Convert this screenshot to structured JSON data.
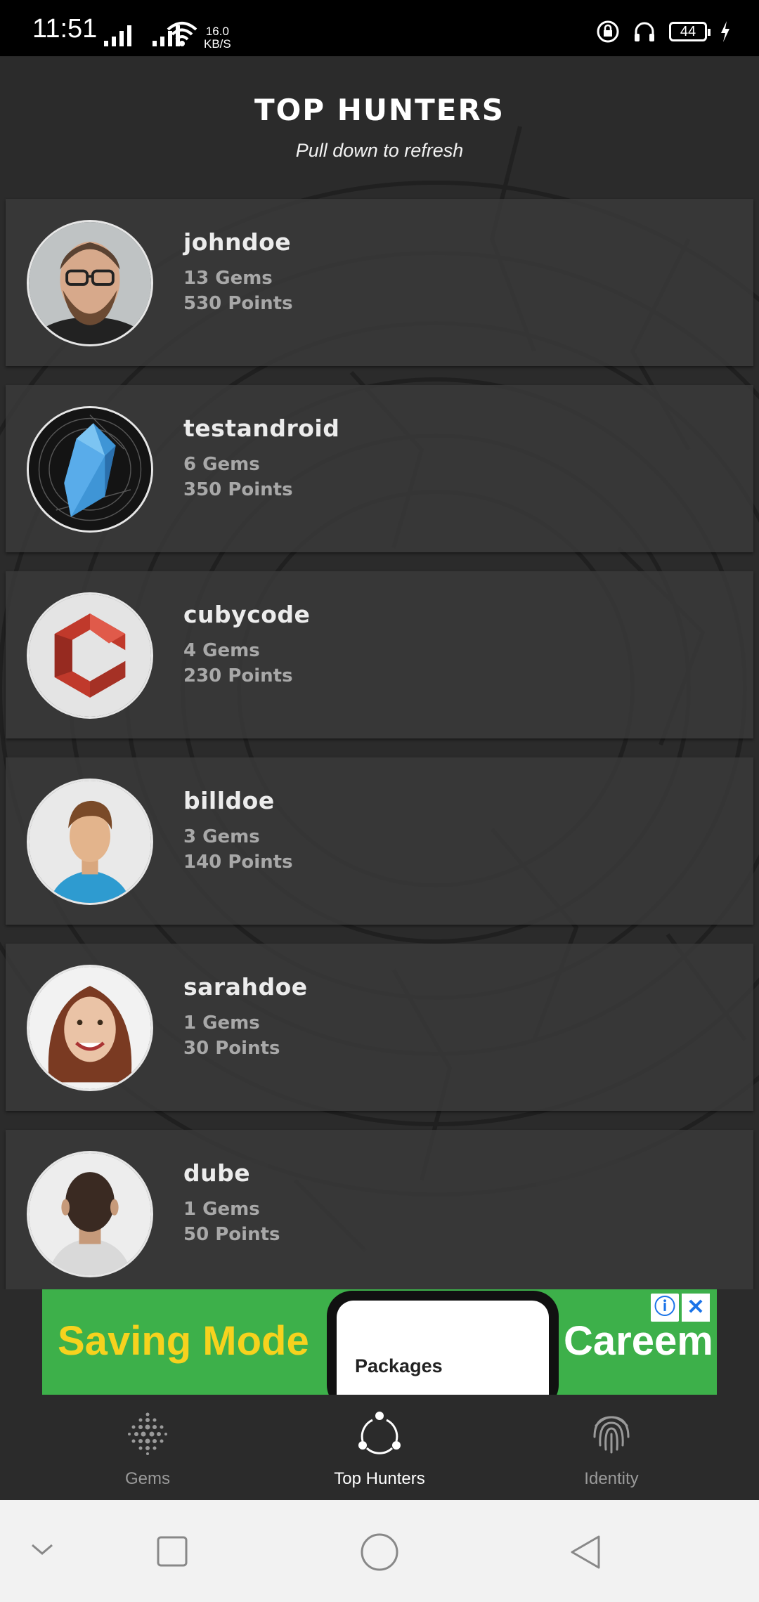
{
  "status_bar": {
    "time": "11:51",
    "speed_value": "16.0",
    "speed_unit": "KB/S",
    "battery": "44"
  },
  "header": {
    "title": "TOP HUNTERS",
    "subtitle": "Pull down to refresh"
  },
  "hunters": [
    {
      "username": "johndoe",
      "gems": "13 Gems",
      "points": "530 Points",
      "avatar": "man-glasses-beard"
    },
    {
      "username": "testandroid",
      "gems": "6 Gems",
      "points": "350 Points",
      "avatar": "blue-crystal"
    },
    {
      "username": "cubycode",
      "gems": "4 Gems",
      "points": "230 Points",
      "avatar": "red-cube-logo"
    },
    {
      "username": "billdoe",
      "gems": "3 Gems",
      "points": "140 Points",
      "avatar": "cartoon-man"
    },
    {
      "username": "sarahdoe",
      "gems": "1 Gems",
      "points": "30 Points",
      "avatar": "woman-curly-hair"
    },
    {
      "username": "dube",
      "gems": "1 Gems",
      "points": "50 Points",
      "avatar": "man-back-of-head"
    }
  ],
  "ad": {
    "headline": "Saving Mode",
    "screen_title": "Packages",
    "brand": "Careem"
  },
  "bottom_nav": {
    "items": [
      {
        "label": "Gems",
        "icon": "dots-grid-icon"
      },
      {
        "label": "Top Hunters",
        "icon": "share-nodes-icon"
      },
      {
        "label": "Identity",
        "icon": "fingerprint-icon"
      }
    ],
    "active": "Top Hunters"
  },
  "colors": {
    "background": "#2b2b2b",
    "card": "#3a3a3a",
    "stat_text": "#a8a8a8",
    "ad_green": "#3db04a",
    "ad_yellow": "#f6d21e"
  }
}
